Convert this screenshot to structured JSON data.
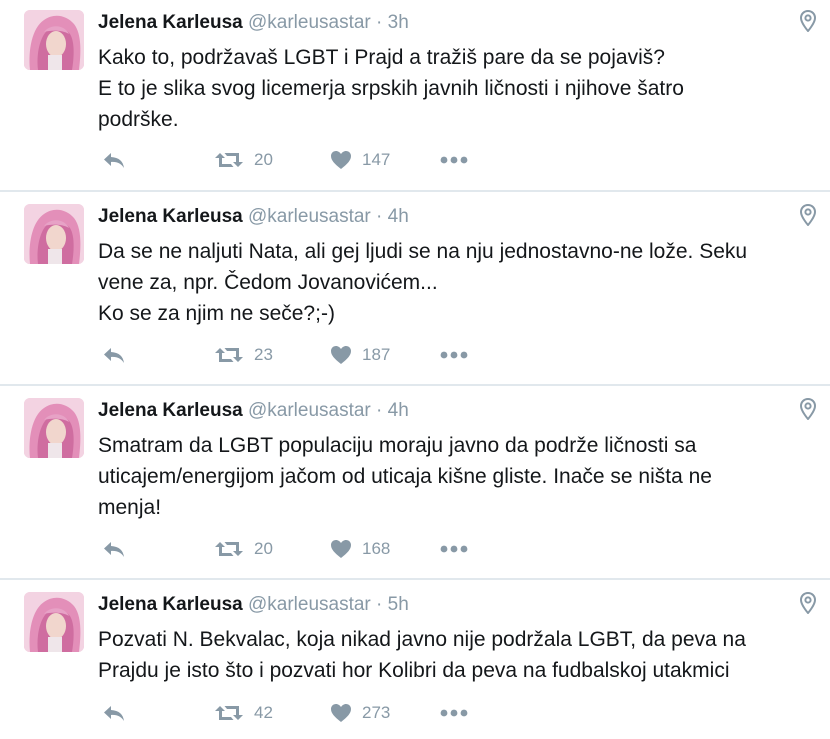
{
  "tweets": [
    {
      "name": "Jelena Karleusa",
      "handle": "@karleusastar",
      "separator": "·",
      "time": "3h",
      "lines": [
        "Kako to, podržavaš LGBT i Prajd a tražiš pare da se pojaviš?",
        "E to je slika svog licemerja srpskih javnih ličnosti i njihove šatro",
        "podrške."
      ],
      "retweets": "20",
      "likes": "147"
    },
    {
      "name": "Jelena Karleusa",
      "handle": "@karleusastar",
      "separator": "·",
      "time": "4h",
      "lines": [
        "Da se ne naljuti Nata, ali gej ljudi se na nju jednostavno-ne lože. Seku",
        "vene za, npr. Čedom Jovanovićem...",
        "Ko se za njim ne seče?;-)"
      ],
      "retweets": "23",
      "likes": "187"
    },
    {
      "name": "Jelena Karleusa",
      "handle": "@karleusastar",
      "separator": "·",
      "time": "4h",
      "lines": [
        "Smatram da LGBT populaciju moraju javno da podrže ličnosti sa",
        "uticajem/energijom jačom od uticaja kišne gliste. Inače se ništa ne",
        "menja!"
      ],
      "retweets": "20",
      "likes": "168"
    },
    {
      "name": "Jelena Karleusa",
      "handle": "@karleusastar",
      "separator": "·",
      "time": "5h",
      "lines": [
        "Pozvati N. Bekvalac, koja nikad javno nije podržala LGBT, da peva na",
        "Prajdu je isto što i pozvati hor Kolibri da peva na fudbalskoj utakmici"
      ],
      "retweets": "42",
      "likes": "273"
    }
  ],
  "icons": {
    "reply": "reply-icon",
    "retweet": "retweet-icon",
    "like": "heart-icon",
    "more": "more-dots-icon",
    "location": "location-pin-icon"
  },
  "colors": {
    "icon_gray": "#8899a6",
    "text": "#14171a",
    "divider": "#e1e8ed"
  }
}
